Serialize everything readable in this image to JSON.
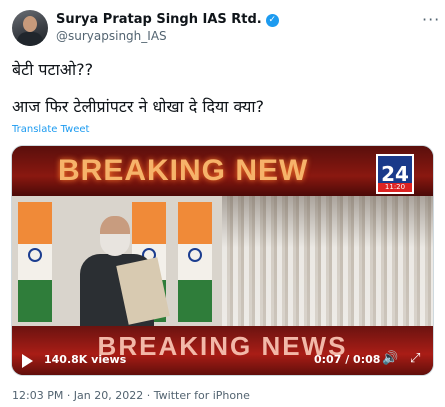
{
  "tweet": {
    "author_name": "Surya Pratap Singh IAS Rtd.",
    "handle": "@suryapsingh_IAS",
    "verified_icon": "✓",
    "more_icon": "···",
    "text_line1": "बेटी पटाओ??",
    "text_line2": "आज फिर टेलीप्रांपटर ने धोखा दे दिया क्या?",
    "translate_label": "Translate Tweet",
    "timestamp": "12:03 PM · Jan 20, 2022 · Twitter for iPhone"
  },
  "video": {
    "top_banner_text": "BREAKING NEW",
    "channel_logo_number": "24",
    "channel_logo_time": "11:20",
    "bottom_banner_text": "BREAKING NEWS",
    "views": "140.8K views",
    "time": "0:07 / 0:08",
    "play_icon": "play-icon",
    "volume_icon": "🔊",
    "fullscreen_icon": "⤢"
  },
  "colors": {
    "accent": "#1d9bf0",
    "secondary_text": "#536471",
    "banner_red": "#a91d16"
  }
}
